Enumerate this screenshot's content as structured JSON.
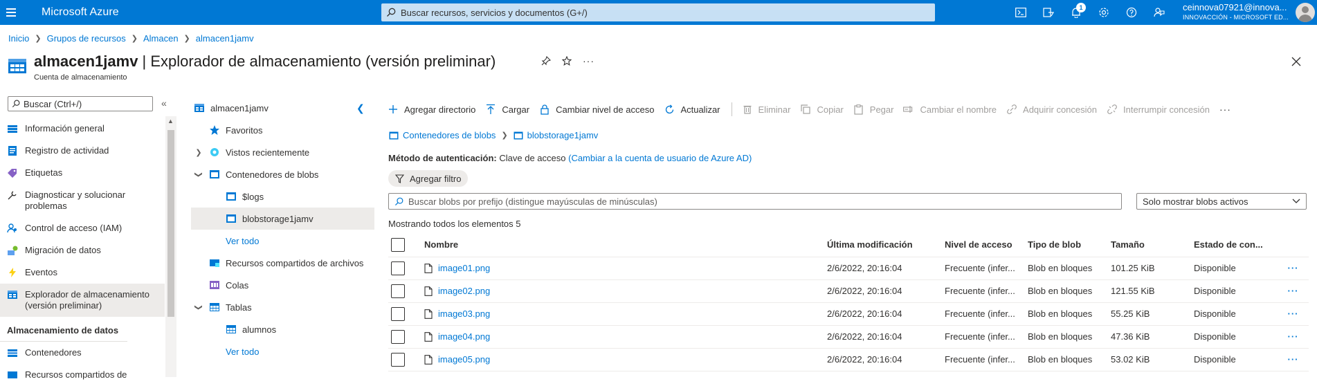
{
  "topbar": {
    "brand": "Microsoft Azure",
    "search_placeholder": "Buscar recursos, servicios y documentos (G+/)",
    "notifications_count": "1",
    "account_user": "ceinnova07921@innova...",
    "account_org": "INNOVACCIÓN - MICROSOFT ED..."
  },
  "breadcrumb": [
    "Inicio",
    "Grupos de recursos",
    "Almacen",
    "almacen1jamv"
  ],
  "page": {
    "resource_name": "almacen1jamv",
    "title_rest": " | Explorador de almacenamiento (versión preliminar)",
    "subtitle": "Cuenta de almacenamiento"
  },
  "leftmenu": {
    "search_placeholder": "Buscar (Ctrl+/)",
    "items": [
      {
        "label": "Información general",
        "icon": "overview-icon"
      },
      {
        "label": "Registro de actividad",
        "icon": "activity-log-icon"
      },
      {
        "label": "Etiquetas",
        "icon": "tag-icon"
      },
      {
        "label": "Diagnosticar y solucionar problemas",
        "icon": "wrench-icon"
      },
      {
        "label": "Control de acceso (IAM)",
        "icon": "iam-icon"
      },
      {
        "label": "Migración de datos",
        "icon": "migration-icon"
      },
      {
        "label": "Eventos",
        "icon": "lightning-icon"
      },
      {
        "label": "Explorador de almacenamiento (versión preliminar)",
        "icon": "storage-explorer-icon"
      }
    ],
    "section_title": "Almacenamiento de datos",
    "section_items": [
      {
        "label": "Contenedores",
        "icon": "containers-icon"
      },
      {
        "label": "Recursos compartidos de",
        "icon": "file-share-icon"
      }
    ]
  },
  "tree": {
    "root": "almacen1jamv",
    "favorites": "Favoritos",
    "recent": "Vistos recientemente",
    "containers": "Contenedores de blobs",
    "container_items": [
      "$logs",
      "blobstorage1jamv"
    ],
    "see_all": "Ver todo",
    "file_shares": "Recursos compartidos de archivos",
    "queues": "Colas",
    "tables": "Tablas",
    "table_items": [
      "alumnos"
    ],
    "see_all_2": "Ver todo"
  },
  "toolbar": {
    "add_directory": "Agregar directorio",
    "upload": "Cargar",
    "change_access": "Cambiar nivel de acceso",
    "refresh": "Actualizar",
    "delete": "Eliminar",
    "copy": "Copiar",
    "paste": "Pegar",
    "rename": "Cambiar el nombre",
    "acquire_lease": "Adquirir concesión",
    "break_lease": "Interrumpir concesión",
    "more": "···"
  },
  "path": [
    "Contenedores de blobs",
    "blobstorage1jamv"
  ],
  "auth": {
    "label": "Método de autenticación:",
    "value": "Clave de acceso",
    "link": "(Cambiar a la cuenta de usuario de Azure AD)"
  },
  "filter": {
    "add_filter": "Agregar filtro",
    "search_placeholder": "Buscar blobs por prefijo (distingue mayúsculas de minúsculas)",
    "dropdown_value": "Solo mostrar blobs activos"
  },
  "showing": "Mostrando todos los elementos 5",
  "table": {
    "headers": [
      "Nombre",
      "Última modificación",
      "Nivel de acceso",
      "Tipo de blob",
      "Tamaño",
      "Estado de con..."
    ],
    "rows": [
      {
        "name": "image01.png",
        "modified": "2/6/2022, 20:16:04",
        "tier": "Frecuente (infer...",
        "type": "Blob en bloques",
        "size": "101.25 KiB",
        "state": "Disponible"
      },
      {
        "name": "image02.png",
        "modified": "2/6/2022, 20:16:04",
        "tier": "Frecuente (infer...",
        "type": "Blob en bloques",
        "size": "121.55 KiB",
        "state": "Disponible"
      },
      {
        "name": "image03.png",
        "modified": "2/6/2022, 20:16:04",
        "tier": "Frecuente (infer...",
        "type": "Blob en bloques",
        "size": "55.25 KiB",
        "state": "Disponible"
      },
      {
        "name": "image04.png",
        "modified": "2/6/2022, 20:16:04",
        "tier": "Frecuente (infer...",
        "type": "Blob en bloques",
        "size": "47.36 KiB",
        "state": "Disponible"
      },
      {
        "name": "image05.png",
        "modified": "2/6/2022, 20:16:04",
        "tier": "Frecuente (infer...",
        "type": "Blob en bloques",
        "size": "53.02 KiB",
        "state": "Disponible"
      }
    ],
    "row_more": "···"
  },
  "colors": {
    "azure_blue": "#0078d4",
    "selected_bg": "#edebe9"
  }
}
